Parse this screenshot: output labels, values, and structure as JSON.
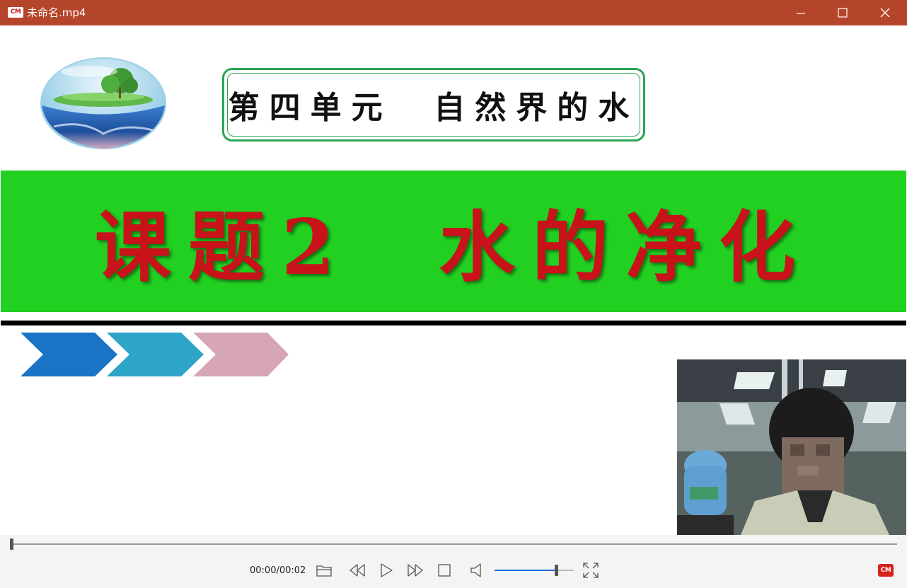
{
  "window": {
    "app_logo_text": "CM",
    "title": "未命名.mp4"
  },
  "slide": {
    "unit_title": "第四单元  自然界的水",
    "lesson_title": "课题2  水的净化",
    "band_color": "#22d022",
    "lesson_title_color": "#c9121a",
    "chevron_colors": [
      "#1a73c4",
      "#2da4c8",
      "#d6a6b4"
    ]
  },
  "player": {
    "time_display": "00:00/00:02",
    "progress": 0,
    "volume": 0.78,
    "brand_logo_text": "CM",
    "accent_color": "#1a6fd1"
  }
}
